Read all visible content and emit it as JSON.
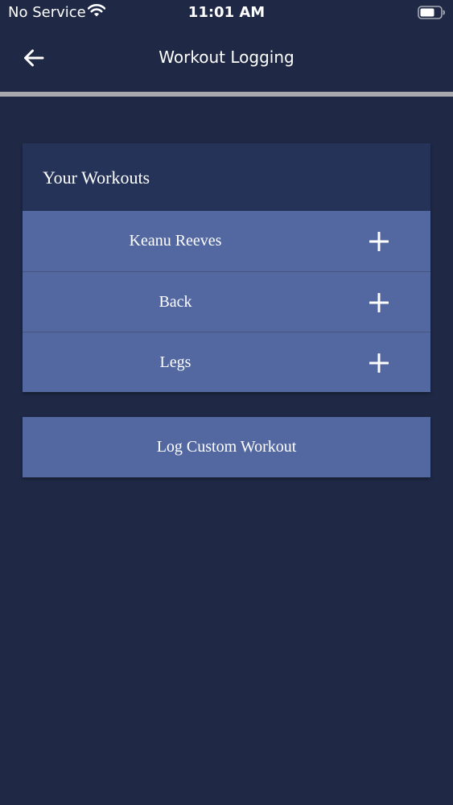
{
  "status_bar": {
    "carrier": "No Service",
    "time": "11:01 AM",
    "wifi_icon": "wifi-icon",
    "battery_icon": "battery-icon"
  },
  "nav": {
    "title": "Workout Logging",
    "back_icon": "arrow-left-icon"
  },
  "workouts_card": {
    "title": "Your Workouts",
    "items": [
      {
        "label": "Keanu Reeves",
        "action_icon": "plus-icon"
      },
      {
        "label": "Back",
        "action_icon": "plus-icon"
      },
      {
        "label": "Legs",
        "action_icon": "plus-icon"
      }
    ]
  },
  "custom_workout_button": {
    "label": "Log Custom Workout"
  },
  "colors": {
    "background": "#1f2945",
    "card": "#243357",
    "row": "#5368a1",
    "divider": "#a7a9ae",
    "text": "#ffffff"
  }
}
